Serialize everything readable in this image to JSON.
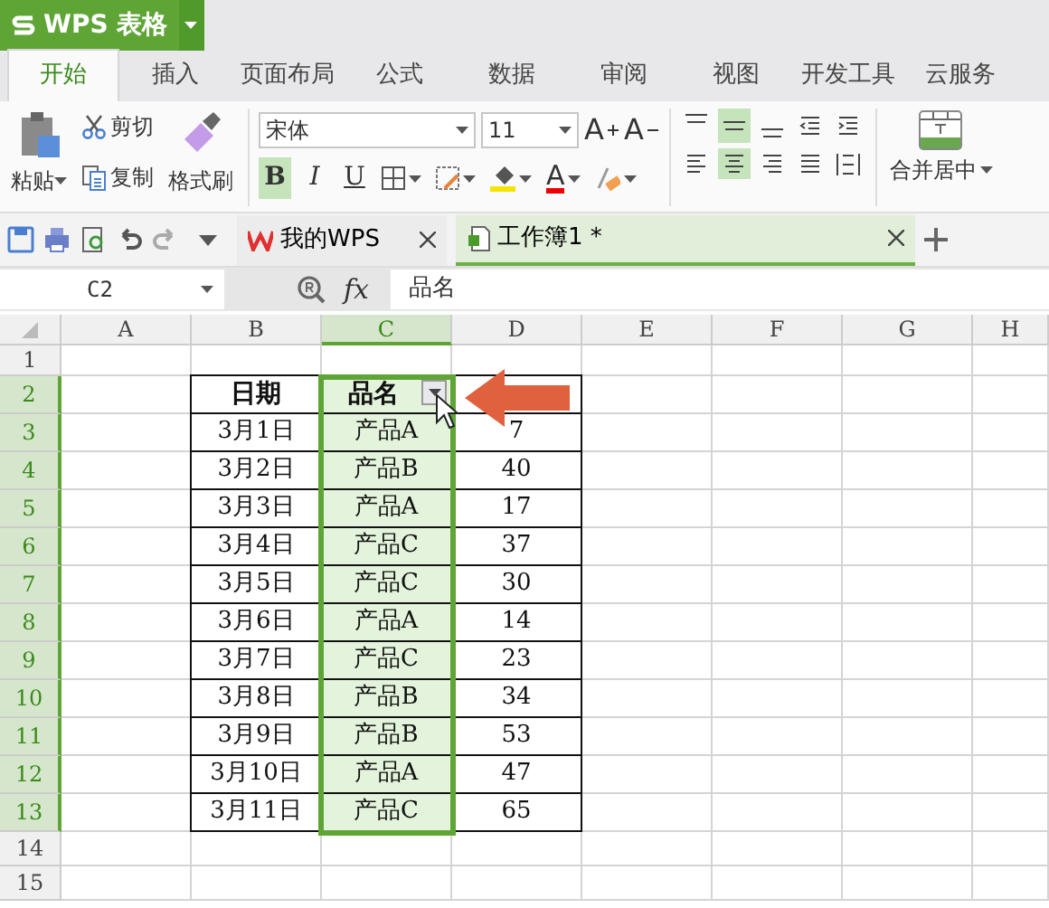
{
  "app": {
    "title": "WPS 表格"
  },
  "ribbon_tabs": [
    {
      "label": "开始",
      "selected": true
    },
    {
      "label": "插入",
      "selected": false
    },
    {
      "label": "页面布局",
      "selected": false
    },
    {
      "label": "公式",
      "selected": false
    },
    {
      "label": "数据",
      "selected": false
    },
    {
      "label": "审阅",
      "selected": false
    },
    {
      "label": "视图",
      "selected": false
    },
    {
      "label": "开发工具",
      "selected": false
    },
    {
      "label": "云服务",
      "selected": false
    }
  ],
  "clipboard": {
    "paste": "粘贴",
    "cut": "剪切",
    "copy": "复制",
    "format_painter": "格式刷"
  },
  "font": {
    "name": "宋体",
    "size": "11",
    "grow": "A",
    "shrink": "A",
    "color_letter": "A"
  },
  "format_buttons": [
    {
      "label": "B",
      "selected": true
    },
    {
      "label": "I",
      "selected": false
    },
    {
      "label": "U",
      "selected": false
    }
  ],
  "align_top": [
    {
      "kind": "top",
      "selected": false
    },
    {
      "kind": "middle",
      "selected": true
    },
    {
      "kind": "bottom",
      "selected": false
    }
  ],
  "align_bottom": [
    {
      "kind": "left",
      "selected": false
    },
    {
      "kind": "center",
      "selected": true
    },
    {
      "kind": "right",
      "selected": false
    },
    {
      "kind": "justify",
      "selected": false
    },
    {
      "kind": "distributed",
      "selected": false
    }
  ],
  "merge": {
    "label": "合并居中"
  },
  "doc_tabs": [
    {
      "label": "我的WPS",
      "selected": false,
      "kind": "home"
    },
    {
      "label": "工作簿1 *",
      "selected": true,
      "kind": "sheet"
    }
  ],
  "formula_bar": {
    "cell_ref": "C2",
    "fx": "fx",
    "content": "品名"
  },
  "columns": [
    {
      "label": "A",
      "selected": false
    },
    {
      "label": "B",
      "selected": false
    },
    {
      "label": "C",
      "selected": true
    },
    {
      "label": "D",
      "selected": false
    },
    {
      "label": "E",
      "selected": false
    },
    {
      "label": "F",
      "selected": false
    },
    {
      "label": "G",
      "selected": false
    },
    {
      "label": "H",
      "selected": false
    }
  ],
  "rows": [
    {
      "label": "1",
      "selected": false
    },
    {
      "label": "2",
      "selected": true
    },
    {
      "label": "3",
      "selected": true
    },
    {
      "label": "4",
      "selected": true
    },
    {
      "label": "5",
      "selected": true
    },
    {
      "label": "6",
      "selected": true
    },
    {
      "label": "7",
      "selected": true
    },
    {
      "label": "8",
      "selected": true
    },
    {
      "label": "9",
      "selected": true
    },
    {
      "label": "10",
      "selected": true
    },
    {
      "label": "11",
      "selected": true
    },
    {
      "label": "12",
      "selected": true
    },
    {
      "label": "13",
      "selected": true
    },
    {
      "label": "14",
      "selected": false
    },
    {
      "label": "15",
      "selected": false
    }
  ],
  "data_table": {
    "header": [
      "日期",
      "品名"
    ],
    "rows": [
      [
        "3月1日",
        "产品A",
        "7"
      ],
      [
        "3月2日",
        "产品B",
        "40"
      ],
      [
        "3月3日",
        "产品A",
        "17"
      ],
      [
        "3月4日",
        "产品C",
        "37"
      ],
      [
        "3月5日",
        "产品C",
        "30"
      ],
      [
        "3月6日",
        "产品A",
        "14"
      ],
      [
        "3月7日",
        "产品C",
        "23"
      ],
      [
        "3月8日",
        "产品B",
        "34"
      ],
      [
        "3月9日",
        "产品B",
        "53"
      ],
      [
        "3月10日",
        "产品A",
        "47"
      ],
      [
        "3月11日",
        "产品C",
        "65"
      ]
    ]
  }
}
